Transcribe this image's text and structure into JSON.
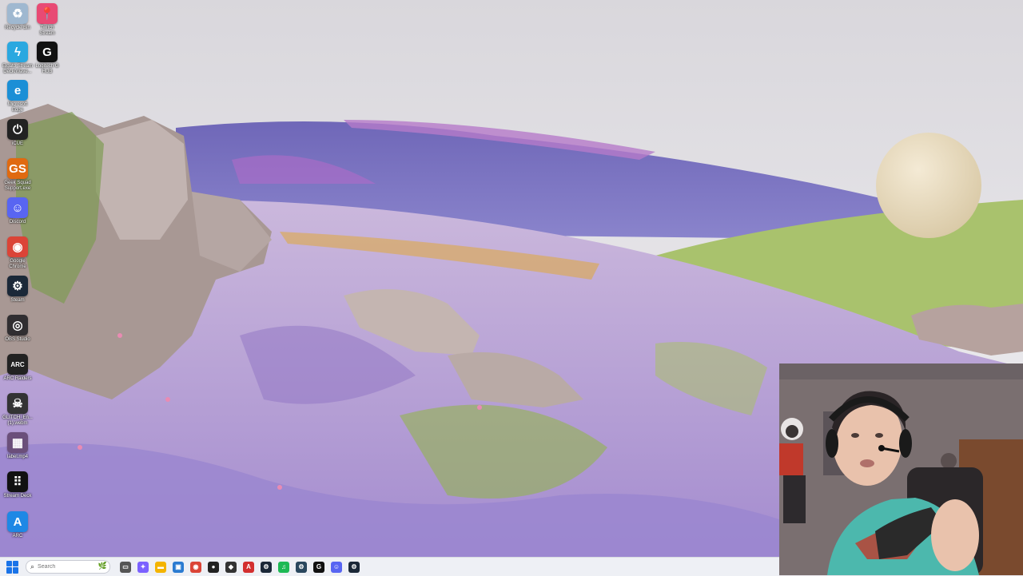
{
  "desktop": {
    "icons": [
      {
        "name": "recycle-bin-icon",
        "label": "Recycle Bin",
        "glyph": "♻",
        "color": "#9fb8d0"
      },
      {
        "name": "twitch-stream-icon",
        "label": "Twitch\nStream",
        "glyph": "📍",
        "color": "#e84a74"
      },
      {
        "name": "elgato-wave-icon",
        "label": "Elgato Stream\nDeck/Wave...",
        "glyph": "ϟ",
        "color": "#2aa8e0"
      },
      {
        "name": "logitech-ghub-icon",
        "label": "Logitech G\nHUB",
        "glyph": "G",
        "color": "#111111"
      },
      {
        "name": "microsoft-edge-icon",
        "label": "Microsoft\nEdge",
        "glyph": "e",
        "color": "#1b8fd6"
      },
      {
        "name": "icue-icon",
        "label": "iCUE",
        "glyph": "⏻",
        "color": "#222222"
      },
      {
        "name": "geek-squad-icon",
        "label": "Geek Squad\nSupport.exe",
        "glyph": "GS",
        "color": "#e06a10"
      },
      {
        "name": "discord-icon",
        "label": "Discord",
        "glyph": "☺",
        "color": "#5865f2"
      },
      {
        "name": "google-chrome-icon",
        "label": "Google\nChrome",
        "glyph": "◉",
        "color": "#db4437"
      },
      {
        "name": "steam-icon",
        "label": "Steam",
        "glyph": "⚙",
        "color": "#1b2838"
      },
      {
        "name": "obs-studio-icon",
        "label": "OBS Studio",
        "glyph": "◎",
        "color": "#302e31"
      },
      {
        "name": "arc-raiders-icon",
        "label": "ARC Raiders",
        "glyph": "ARC",
        "color": "#222222"
      },
      {
        "name": "glitch-file-icon",
        "label": "GLITCH_En...\n(1).webm",
        "glyph": "☠",
        "color": "#333333"
      },
      {
        "name": "video-file-icon",
        "label": "label.mp4",
        "glyph": "▦",
        "color": "#6b4f7a"
      },
      {
        "name": "stream-deck-icon",
        "label": "Stream Deck",
        "glyph": "⠿",
        "color": "#111111"
      },
      {
        "name": "arc-icon",
        "label": "ARC",
        "glyph": "A",
        "color": "#1e88e5"
      }
    ]
  },
  "taskbar": {
    "search_placeholder": "Search",
    "apps": [
      {
        "name": "taskbar-file-manager-icon",
        "glyph": "▭",
        "color": "#555555"
      },
      {
        "name": "taskbar-copilot-icon",
        "glyph": "✦",
        "color": "#7b61ff"
      },
      {
        "name": "taskbar-file-explorer-icon",
        "glyph": "▬",
        "color": "#f4b400"
      },
      {
        "name": "taskbar-store-icon",
        "glyph": "▣",
        "color": "#2b7bd1"
      },
      {
        "name": "taskbar-chrome-icon",
        "glyph": "◉",
        "color": "#db4437"
      },
      {
        "name": "taskbar-app-dark-icon",
        "glyph": "●",
        "color": "#222222"
      },
      {
        "name": "taskbar-geek-icon",
        "glyph": "◆",
        "color": "#333333"
      },
      {
        "name": "taskbar-adobe-icon",
        "glyph": "A",
        "color": "#d32f2f"
      },
      {
        "name": "taskbar-steam-icon",
        "glyph": "⚙",
        "color": "#1b2838"
      },
      {
        "name": "taskbar-spotify-icon",
        "glyph": "♫",
        "color": "#1db954"
      },
      {
        "name": "taskbar-steam2-icon",
        "glyph": "⚙",
        "color": "#2a475e"
      },
      {
        "name": "taskbar-ghub-icon",
        "glyph": "G",
        "color": "#111111"
      },
      {
        "name": "taskbar-discord-icon",
        "glyph": "☺",
        "color": "#5865f2"
      },
      {
        "name": "taskbar-steam3-icon",
        "glyph": "⚙",
        "color": "#1b2838"
      }
    ]
  }
}
